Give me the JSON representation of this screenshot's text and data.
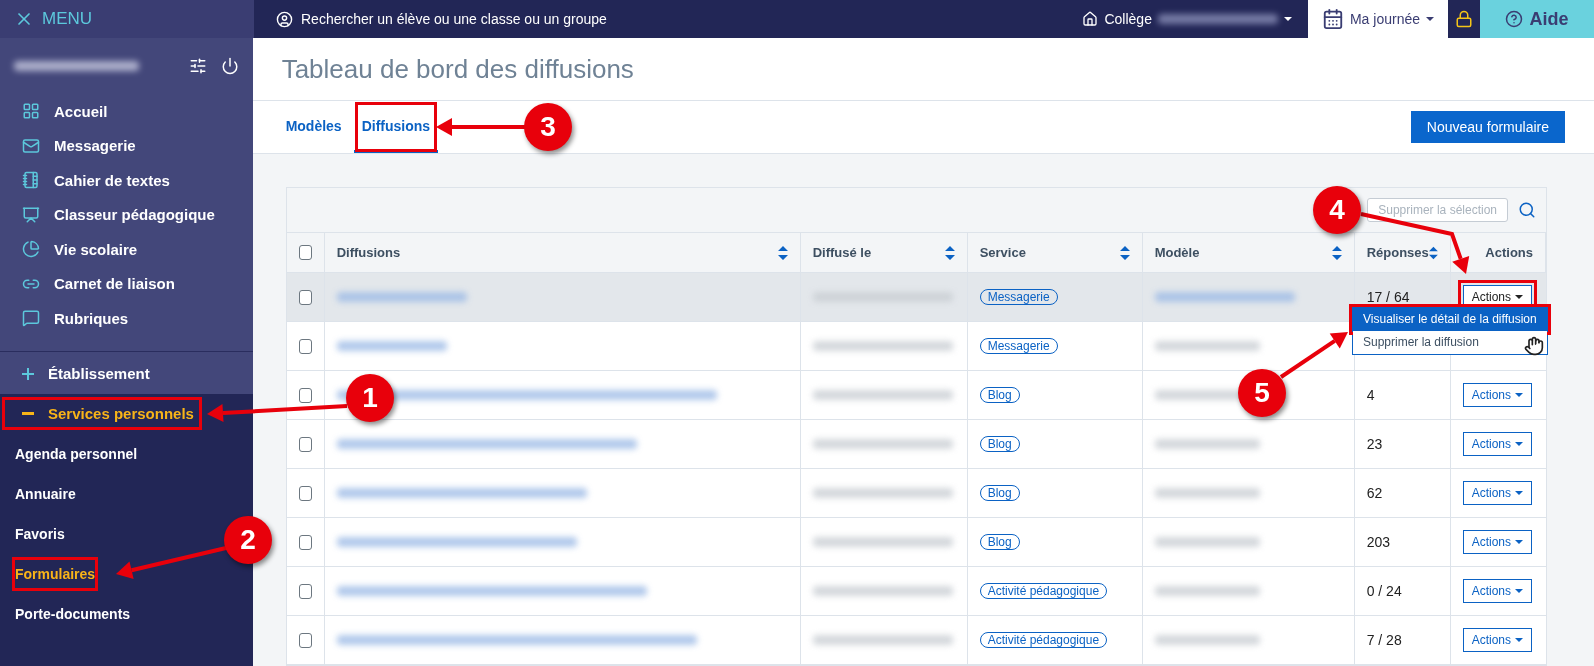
{
  "topbar": {
    "menu": "MENU",
    "search_placeholder": "Rechercher un élève ou une classe ou un groupe",
    "school": "Collège",
    "my_day": "Ma journée",
    "help": "Aide"
  },
  "sidebar": {
    "items": [
      {
        "label": "Accueil"
      },
      {
        "label": "Messagerie"
      },
      {
        "label": "Cahier de textes"
      },
      {
        "label": "Classeur pédagogique"
      },
      {
        "label": "Vie scolaire"
      },
      {
        "label": "Carnet de liaison"
      },
      {
        "label": "Rubriques"
      }
    ],
    "sections": [
      {
        "label": "Établissement",
        "expanded": false,
        "highlighted": false
      },
      {
        "label": "Services personnels",
        "expanded": true,
        "highlighted": true,
        "children": [
          {
            "label": "Agenda personnel",
            "selected": false,
            "highlighted": false
          },
          {
            "label": "Annuaire",
            "selected": false,
            "highlighted": false
          },
          {
            "label": "Favoris",
            "selected": false,
            "highlighted": false
          },
          {
            "label": "Formulaires",
            "selected": true,
            "highlighted": true
          },
          {
            "label": "Porte-documents",
            "selected": false,
            "highlighted": false
          }
        ]
      }
    ]
  },
  "page": {
    "title": "Tableau de bord des diffusions",
    "tabs": [
      {
        "label": "Modèles",
        "selected": false,
        "highlighted": false
      },
      {
        "label": "Diffusions",
        "selected": true,
        "highlighted": true
      }
    ],
    "new_button": "Nouveau formulaire",
    "delete_selection": {
      "label": "Supprimer la sélection",
      "disabled": true
    }
  },
  "table": {
    "all_checked": false,
    "columns": [
      {
        "label": "Diffusions",
        "sortable": true
      },
      {
        "label": "Diffusé le",
        "sortable": true
      },
      {
        "label": "Service",
        "sortable": true
      },
      {
        "label": "Modèle",
        "sortable": true
      },
      {
        "label": "Réponses",
        "sortable": true
      },
      {
        "label": "Actions",
        "sortable": false
      }
    ],
    "rows": [
      {
        "checked": false,
        "hovered": true,
        "service": "Messagerie",
        "model_link": true,
        "responses": "17 / 64",
        "action": "Actions",
        "highlighted": true
      },
      {
        "checked": false,
        "hovered": false,
        "service": "Messagerie",
        "model_link": false
      },
      {
        "checked": false,
        "hovered": false,
        "service": "Blog",
        "model_link": false,
        "responses": "4",
        "action": "Actions",
        "highlighted": false
      },
      {
        "checked": false,
        "hovered": false,
        "service": "Blog",
        "model_link": false,
        "responses": "23",
        "action": "Actions",
        "highlighted": false
      },
      {
        "checked": false,
        "hovered": false,
        "service": "Blog",
        "model_link": false,
        "responses": "62",
        "action": "Actions",
        "highlighted": false
      },
      {
        "checked": false,
        "hovered": false,
        "service": "Blog",
        "model_link": false,
        "responses": "203",
        "action": "Actions",
        "highlighted": false
      },
      {
        "checked": false,
        "hovered": false,
        "service": "Activité pédagogique",
        "model_link": false,
        "responses": "0 / 24",
        "action": "Actions",
        "highlighted": false
      },
      {
        "checked": false,
        "hovered": false,
        "service": "Activité pédagogique",
        "model_link": false,
        "responses": "7 / 28",
        "action": "Actions",
        "highlighted": false
      }
    ],
    "dropdown": [
      {
        "label": "Visualiser le détail de la diffusion",
        "selected": true,
        "highlighted": true
      },
      {
        "label": "Supprimer la diffusion",
        "selected": false,
        "highlighted": false
      }
    ]
  },
  "annotations": [
    {
      "number": "1"
    },
    {
      "number": "2"
    },
    {
      "number": "3"
    },
    {
      "number": "4"
    },
    {
      "number": "5"
    }
  ]
}
